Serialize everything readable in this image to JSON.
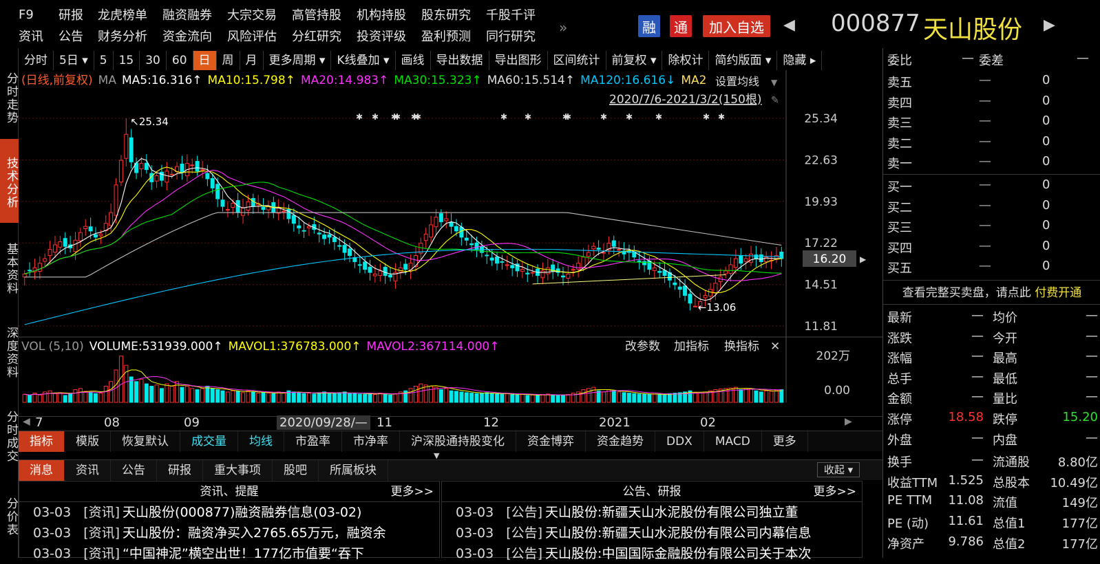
{
  "nav_row1": [
    "F9",
    "研报",
    "龙虎榜单",
    "融资融券",
    "大宗交易",
    "高管持股",
    "机构持股",
    "股东研究",
    "千股千评"
  ],
  "nav_row2": [
    "资讯",
    "公告",
    "财务分析",
    "资金流向",
    "风险评估",
    "分红研究",
    "投资评级",
    "盈利预测",
    "同行研究"
  ],
  "more_glyph": "»",
  "header": {
    "rong": "融",
    "tong": "通",
    "add": "加入自选",
    "code": "000877",
    "name": "天山股份",
    "prev": "◀",
    "next": "▶"
  },
  "left_tabs": [
    "分时走势",
    "技术分析",
    "基本资料",
    "深度资料",
    "分时成交",
    "分价表"
  ],
  "toolbar": [
    "分时",
    "5日 ▾",
    "5",
    "15",
    "30",
    "60",
    "日",
    "周",
    "月",
    "更多周期 ▾",
    "K线叠加 ▾",
    "画线",
    "导出数据",
    "导出图形",
    "区间统计",
    "前复权 ▾",
    "除权计",
    "简约版面 ▾",
    "隐藏 ▸"
  ],
  "toolbar_active": "日",
  "ma_bar": {
    "tag": "(日线,前复权)",
    "ma": "MA",
    "ma5": "MA5:16.316↑",
    "ma10": "MA10:15.798↑",
    "ma20": "MA20:14.983↑",
    "ma30": "MA30:15.323↑",
    "ma60": "MA60:15.514↑",
    "ma120": "MA120:16.616↓",
    "ma250": "MA2",
    "set": "设置均线",
    "range": "2020/7/6-2021/3/2(150根)"
  },
  "colors": {
    "up": "#ff3030",
    "down": "#00e8e8",
    "ma5": "#ffffff",
    "ma10": "#ffff00",
    "ma20": "#ff30ff",
    "ma30": "#00e000",
    "ma60": "#c0c0c0",
    "ma120": "#00c8ff",
    "accent": "#e05a1a"
  },
  "price_axis": [
    "25.34",
    "22.63",
    "19.93",
    "17.22",
    "14.51",
    "11.81"
  ],
  "current_price": "16.20",
  "annotations": {
    "high": "↖25.34",
    "low": "←13.06"
  },
  "volume_bar": {
    "title": "VOL (5,10)",
    "volume": "VOLUME:531939.000↑",
    "mavol1": "MAVOL1:376783.000↑",
    "mavol2": "MAVOL2:367114.000↑",
    "btn1": "改参数",
    "btn2": "加指标",
    "btn3": "换指标",
    "close": "✕"
  },
  "vol_axis": [
    "202万",
    "0.00"
  ],
  "x_axis": [
    "7",
    "08",
    "09",
    "2020/09/28/—",
    "11",
    "12",
    "2021",
    "02"
  ],
  "indicator_tabs": [
    "指标",
    "模版",
    "恢复默认",
    "成交量",
    "均线",
    "市盈率",
    "市净率",
    "沪深股通持股变化",
    "资金博弈",
    "资金趋势",
    "DDX",
    "MACD",
    "更多"
  ],
  "news_tabs": [
    "消息",
    "资讯",
    "公告",
    "研报",
    "重大事项",
    "股吧",
    "所属板块"
  ],
  "collapse": "收起 ▾",
  "news_left": {
    "title": "资讯、提醒",
    "more": "更多>>",
    "items": [
      {
        "date": "03-03",
        "type": "[资讯]",
        "text": "天山股份(000877)融资融券信息(03-02)"
      },
      {
        "date": "03-03",
        "type": "[资讯]",
        "text": "天山股份：融资净买入2765.65万元，融资余"
      },
      {
        "date": "03-03",
        "type": "[资讯]",
        "text": "“中国神泥”横空出世！177亿市值要“吞下"
      }
    ]
  },
  "news_right": {
    "title": "公告、研报",
    "more": "更多>>",
    "items": [
      {
        "date": "03-03",
        "type": "[公告]",
        "text": "天山股份:新疆天山水泥股份有限公司独立董"
      },
      {
        "date": "03-03",
        "type": "[公告]",
        "text": "天山股份:新疆天山水泥股份有限公司内幕信息"
      },
      {
        "date": "03-03",
        "type": "[公告]",
        "text": "天山股份:中国国际金融股份有限公司关于本次"
      }
    ]
  },
  "orderbook": {
    "head_l": "委比",
    "head_l_val": "—",
    "head_r": "委差",
    "head_r_val": "—",
    "sell": [
      {
        "label": "卖五",
        "p": "—",
        "v": "0"
      },
      {
        "label": "卖四",
        "p": "—",
        "v": "0"
      },
      {
        "label": "卖三",
        "p": "—",
        "v": "0"
      },
      {
        "label": "卖二",
        "p": "—",
        "v": "0"
      },
      {
        "label": "卖一",
        "p": "—",
        "v": "0"
      }
    ],
    "buy": [
      {
        "label": "买一",
        "p": "—",
        "v": "0"
      },
      {
        "label": "买二",
        "p": "—",
        "v": "0"
      },
      {
        "label": "买三",
        "p": "—",
        "v": "0"
      },
      {
        "label": "买四",
        "p": "—",
        "v": "0"
      },
      {
        "label": "买五",
        "p": "—",
        "v": "0"
      }
    ],
    "notice": "查看完整买卖盘，请点此",
    "pay": "付费开通"
  },
  "quotes": [
    {
      "l": "最新",
      "lv": "—",
      "r": "均价",
      "rv": "—"
    },
    {
      "l": "涨跌",
      "lv": "—",
      "r": "今开",
      "rv": "—"
    },
    {
      "l": "涨幅",
      "lv": "—",
      "r": "最高",
      "rv": "—"
    },
    {
      "l": "总手",
      "lv": "—",
      "r": "最低",
      "rv": "—"
    },
    {
      "l": "金额",
      "lv": "—",
      "r": "量比",
      "rv": "—"
    },
    {
      "l": "涨停",
      "lv": "18.58",
      "r": "跌停",
      "rv": "15.20"
    },
    {
      "l": "外盘",
      "lv": "—",
      "r": "内盘",
      "rv": "—"
    },
    {
      "l": "换手",
      "lv": "—",
      "r": "流通股",
      "rv": "8.80亿"
    },
    {
      "l": "收益TTM",
      "lv": "1.525",
      "r": "总股本",
      "rv": "10.49亿"
    },
    {
      "l": "PE TTM",
      "lv": "11.08",
      "r": "流值",
      "rv": "149亿"
    },
    {
      "l": "PE (动)",
      "lv": "11.61",
      "r": "总值1",
      "rv": "177亿"
    },
    {
      "l": "净资产",
      "lv": "9.786",
      "r": "总值2",
      "rv": "177亿"
    }
  ],
  "chart_data": {
    "type": "candlestick",
    "y_range": [
      11.81,
      25.34
    ],
    "period": "2020/7/6-2021/3/2",
    "closes": [
      15.2,
      15.4,
      15.6,
      15.9,
      16.2,
      16.8,
      17.1,
      17.3,
      17.0,
      16.9,
      17.4,
      17.9,
      18.3,
      18.0,
      17.6,
      17.8,
      18.5,
      19.2,
      21.0,
      22.6,
      24.3,
      22.5,
      21.8,
      22.4,
      22.0,
      21.2,
      21.6,
      21.3,
      21.9,
      21.7,
      22.2,
      21.8,
      22.4,
      22.3,
      21.9,
      22.0,
      21.4,
      20.8,
      20.1,
      19.6,
      19.4,
      19.8,
      19.2,
      19.5,
      19.9,
      19.6,
      19.8,
      19.4,
      19.6,
      19.2,
      19.5,
      19.3,
      18.8,
      18.5,
      18.2,
      18.0,
      18.3,
      18.1,
      17.8,
      17.5,
      17.6,
      17.3,
      17.0,
      16.6,
      16.4,
      16.0,
      15.8,
      15.5,
      15.3,
      15.2,
      15.4,
      15.1,
      15.0,
      15.3,
      15.6,
      15.5,
      15.9,
      16.4,
      17.2,
      17.8,
      18.4,
      18.9,
      18.6,
      18.8,
      18.3,
      18.0,
      17.6,
      17.4,
      17.1,
      16.8,
      16.6,
      16.4,
      16.1,
      15.9,
      16.0,
      15.8,
      15.6,
      15.4,
      15.5,
      15.2,
      15.3,
      15.1,
      15.4,
      15.6,
      15.4,
      15.3,
      15.0,
      15.2,
      15.5,
      15.9,
      16.3,
      16.6,
      17.0,
      16.8,
      16.6,
      17.2,
      17.0,
      16.8,
      16.5,
      16.6,
      16.3,
      16.0,
      15.8,
      15.5,
      15.6,
      15.3,
      15.1,
      14.8,
      14.5,
      14.2,
      13.8,
      13.3,
      13.1,
      13.4,
      13.8,
      14.2,
      14.6,
      15.0,
      15.4,
      15.8,
      16.2,
      15.9,
      16.2,
      16.5,
      16.2,
      16.0,
      16.3,
      16.1,
      16.4,
      16.2
    ],
    "volumes": [
      0.35,
      0.3,
      0.4,
      0.32,
      0.45,
      0.5,
      0.38,
      0.42,
      0.3,
      0.36,
      0.55,
      0.6,
      0.48,
      0.42,
      0.38,
      0.4,
      0.7,
      0.9,
      1.4,
      2.0,
      1.6,
      1.1,
      0.9,
      1.0,
      0.8,
      0.7,
      0.75,
      0.6,
      0.8,
      0.7,
      0.9,
      0.65,
      0.7,
      0.6,
      0.55,
      0.6,
      0.7,
      0.6,
      0.55,
      0.5,
      0.45,
      0.5,
      0.48,
      0.42,
      0.5,
      0.45,
      0.4,
      0.42,
      0.4,
      0.38,
      0.45,
      0.4,
      0.5,
      0.45,
      0.42,
      0.38,
      0.4,
      0.36,
      0.42,
      0.45,
      0.4,
      0.38,
      0.42,
      0.45,
      0.38,
      0.4,
      0.36,
      0.35,
      0.38,
      0.34,
      0.4,
      0.36,
      0.32,
      0.38,
      0.45,
      0.5,
      0.6,
      0.7,
      0.8,
      0.75,
      0.7,
      0.65,
      0.55,
      0.6,
      0.5,
      0.48,
      0.45,
      0.42,
      0.4,
      0.38,
      0.4,
      0.42,
      0.38,
      0.36,
      0.35,
      0.38,
      0.34,
      0.32,
      0.35,
      0.3,
      0.32,
      0.3,
      0.34,
      0.36,
      0.32,
      0.3,
      0.3,
      0.34,
      0.4,
      0.45,
      0.55,
      0.6,
      0.65,
      0.5,
      0.45,
      0.55,
      0.5,
      0.45,
      0.42,
      0.4,
      0.38,
      0.36,
      0.35,
      0.34,
      0.36,
      0.35,
      0.32,
      0.38,
      0.4,
      0.42,
      0.45,
      0.5,
      0.42,
      0.4,
      0.45,
      0.5,
      0.55,
      0.58,
      0.6,
      0.62,
      0.65,
      0.55,
      0.6,
      0.58,
      0.5,
      0.45,
      0.5,
      0.48,
      0.53,
      0.55
    ]
  }
}
